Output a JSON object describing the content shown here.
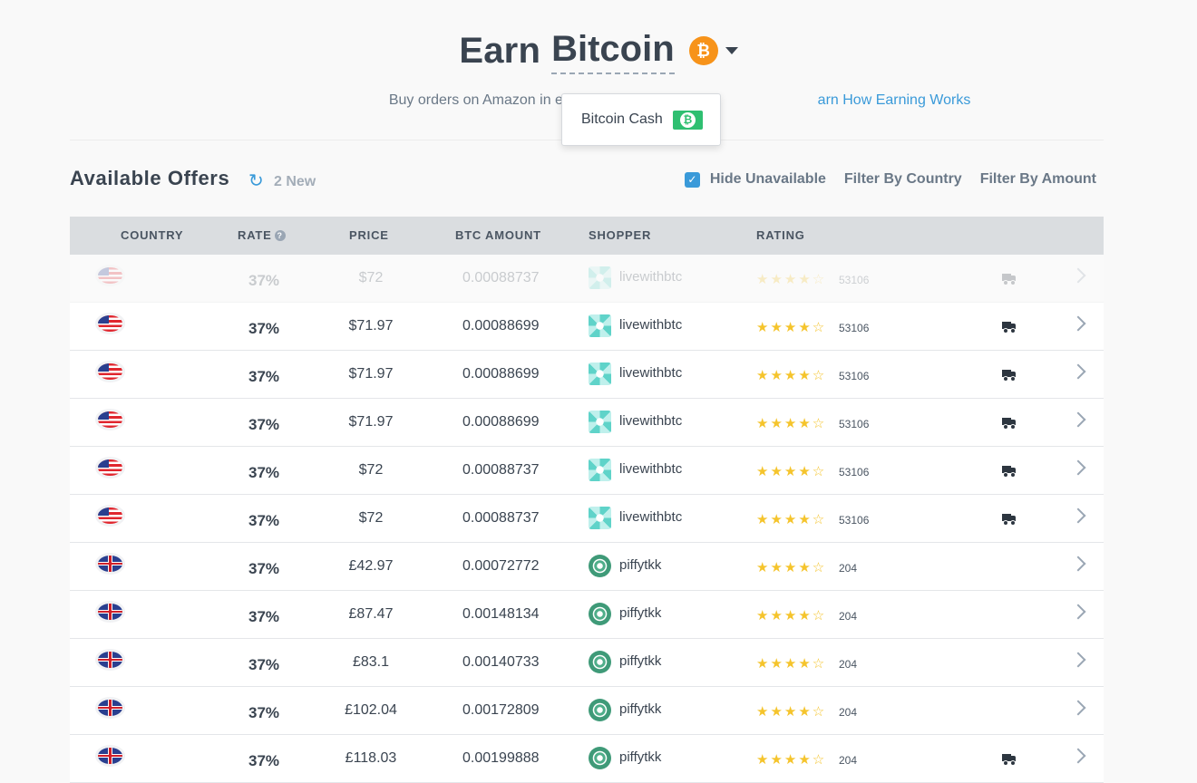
{
  "header": {
    "title": "Earn",
    "currency": "Bitcoin",
    "coin_symbol": "₿",
    "subtitle_lead": "Buy orders on Amazon in exchange for B",
    "subtitle_link": "arn How Earning Works"
  },
  "currency_dropdown": {
    "option_label": "Bitcoin Cash",
    "option_symbol": "₿"
  },
  "offers": {
    "title": "Available Offers",
    "new_label": "2 New",
    "hide_unavailable_label": "Hide Unavailable",
    "hide_unavailable_checked": true,
    "filter_country_label": "Filter By Country",
    "filter_amount_label": "Filter By Amount"
  },
  "table": {
    "columns": {
      "country": "COUNTRY",
      "rate": "RATE",
      "price": "PRICE",
      "btc_amount": "BTC AMOUNT",
      "shopper": "SHOPPER",
      "rating": "RATING"
    },
    "rows": [
      {
        "country": "us",
        "rate": "37%",
        "price": "$72",
        "btc": "0.00088737",
        "shopper": "livewithbtc",
        "avatar": "a",
        "rating": "★★★★☆",
        "count": "53106",
        "truck": true,
        "faded": true
      },
      {
        "country": "us",
        "rate": "37%",
        "price": "$71.97",
        "btc": "0.00088699",
        "shopper": "livewithbtc",
        "avatar": "a",
        "rating": "★★★★☆",
        "count": "53106",
        "truck": true,
        "faded": false
      },
      {
        "country": "us",
        "rate": "37%",
        "price": "$71.97",
        "btc": "0.00088699",
        "shopper": "livewithbtc",
        "avatar": "a",
        "rating": "★★★★☆",
        "count": "53106",
        "truck": true,
        "faded": false
      },
      {
        "country": "us",
        "rate": "37%",
        "price": "$71.97",
        "btc": "0.00088699",
        "shopper": "livewithbtc",
        "avatar": "a",
        "rating": "★★★★☆",
        "count": "53106",
        "truck": true,
        "faded": false
      },
      {
        "country": "us",
        "rate": "37%",
        "price": "$72",
        "btc": "0.00088737",
        "shopper": "livewithbtc",
        "avatar": "a",
        "rating": "★★★★☆",
        "count": "53106",
        "truck": true,
        "faded": false
      },
      {
        "country": "us",
        "rate": "37%",
        "price": "$72",
        "btc": "0.00088737",
        "shopper": "livewithbtc",
        "avatar": "a",
        "rating": "★★★★☆",
        "count": "53106",
        "truck": true,
        "faded": false
      },
      {
        "country": "uk",
        "rate": "37%",
        "price": "£42.97",
        "btc": "0.00072772",
        "shopper": "piffytkk",
        "avatar": "b",
        "rating": "★★★★☆",
        "count": "204",
        "truck": false,
        "faded": false
      },
      {
        "country": "uk",
        "rate": "37%",
        "price": "£87.47",
        "btc": "0.00148134",
        "shopper": "piffytkk",
        "avatar": "b",
        "rating": "★★★★☆",
        "count": "204",
        "truck": false,
        "faded": false
      },
      {
        "country": "uk",
        "rate": "37%",
        "price": "£83.1",
        "btc": "0.00140733",
        "shopper": "piffytkk",
        "avatar": "b",
        "rating": "★★★★☆",
        "count": "204",
        "truck": false,
        "faded": false
      },
      {
        "country": "uk",
        "rate": "37%",
        "price": "£102.04",
        "btc": "0.00172809",
        "shopper": "piffytkk",
        "avatar": "b",
        "rating": "★★★★☆",
        "count": "204",
        "truck": false,
        "faded": false
      },
      {
        "country": "uk",
        "rate": "37%",
        "price": "£118.03",
        "btc": "0.00199888",
        "shopper": "piffytkk",
        "avatar": "b",
        "rating": "★★★★☆",
        "count": "204",
        "truck": true,
        "faded": false
      }
    ]
  },
  "colors": {
    "accent": "#3a9ad9",
    "bitcoin": "#f7931a",
    "bitcoin_cash": "#2fbf71",
    "star": "#f5c42c"
  }
}
